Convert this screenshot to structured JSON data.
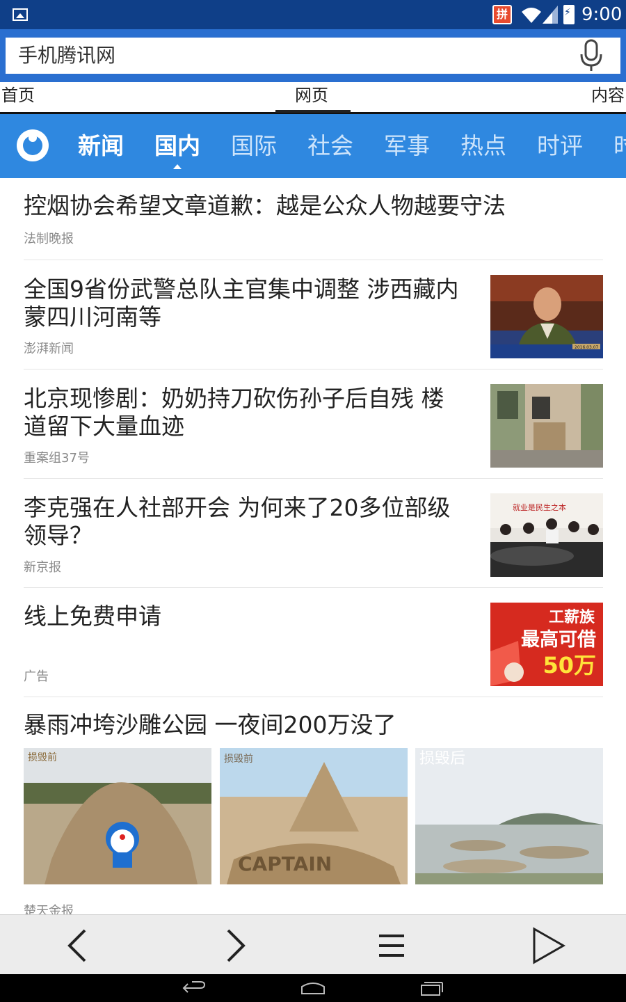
{
  "status_bar": {
    "ime_label": "拼",
    "time": "9:00",
    "icons": [
      "image-icon",
      "ime-icon",
      "wifi-icon",
      "signal-icon",
      "battery-charging-icon"
    ]
  },
  "address_bar": {
    "url_text": "手机腾讯网",
    "mic_icon": "microphone-icon"
  },
  "nav_tabs": {
    "home": "首页",
    "web": "网页",
    "content": "内容"
  },
  "channels": {
    "items": [
      "新闻",
      "国内",
      "国际",
      "社会",
      "军事",
      "热点",
      "时评",
      "时"
    ],
    "active": "国内"
  },
  "news": [
    {
      "title_lines": [
        "控烟协会希望文章道歉：越是公众人物越要守法"
      ],
      "source": "法制晚报"
    },
    {
      "title_lines": [
        "全国9省份武警总队主官集中调整 涉西藏内",
        "蒙四川河南等"
      ],
      "source": "澎湃新闻"
    },
    {
      "title_lines": [
        "北京现惨剧：奶奶持刀砍伤孙子后自残 楼",
        "道留下大量血迹"
      ],
      "source": "重案组37号"
    },
    {
      "title_lines": [
        "李克强在人社部开会 为何来了20多位部级",
        "领导？"
      ],
      "source": "新京报"
    },
    {
      "title_lines": [
        "线上免费申请"
      ],
      "source": "广告",
      "ad_image": {
        "line1": "工薪族",
        "line2": "最高可借",
        "line3": "50万"
      }
    },
    {
      "title_lines": [
        "暴雨冲垮沙雕公园 一夜间200万没了"
      ],
      "source": "楚天金报",
      "gallery_captions": [
        "损毁前",
        "损毁前",
        "损毁后"
      ],
      "gallery_sign": "CAPTAIN"
    }
  ],
  "thumb_captions": {
    "military": "2016.03.07",
    "meeting_banner": "就业是民生之本"
  },
  "toolbar": {
    "icons": [
      "back-arrow-icon",
      "forward-arrow-icon",
      "menu-icon",
      "play-icon"
    ]
  },
  "system_nav": {
    "icons": [
      "system-back-icon",
      "system-home-icon",
      "system-recents-icon"
    ]
  },
  "colors": {
    "status_bar": "#0f3f88",
    "address_bar": "#2a6fd0",
    "channel_bar": "#2f88e0",
    "ad_red": "#d62a1f",
    "ad_yellow": "#ffe33a"
  }
}
